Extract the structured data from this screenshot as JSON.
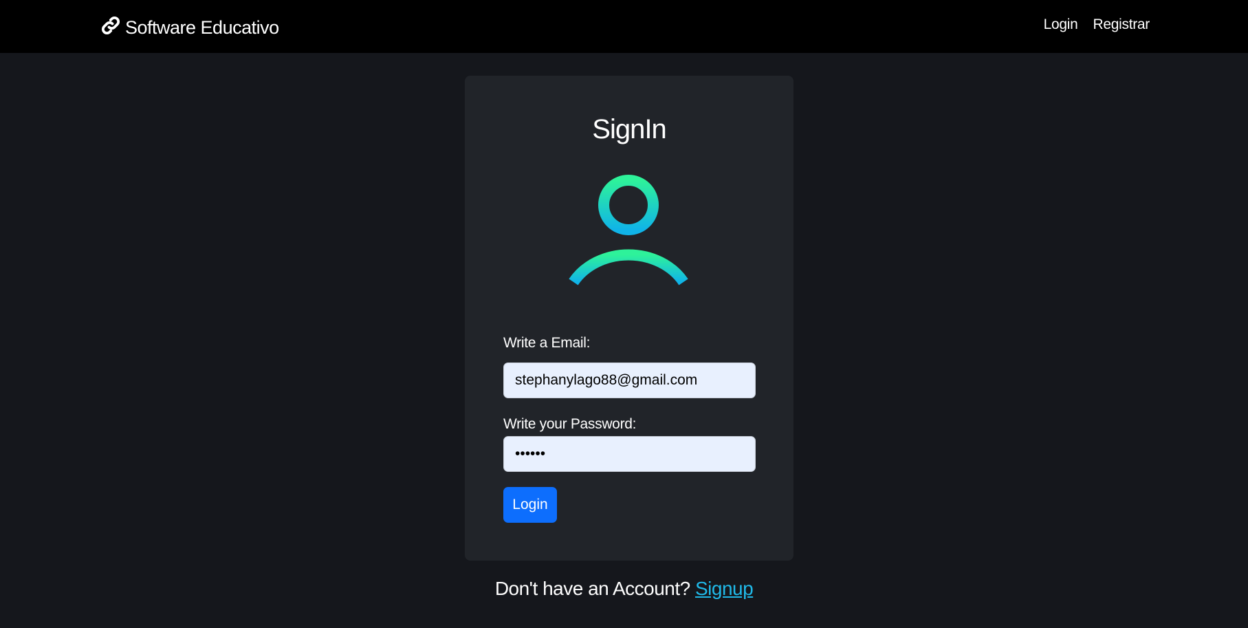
{
  "navbar": {
    "brand": "Software Educativo",
    "brand_icon": "link-icon",
    "links": [
      "Login",
      "Registrar"
    ]
  },
  "card": {
    "title": "SignIn",
    "avatar_icon": "user-icon",
    "gradient": [
      "#2ef29a",
      "#10b4e8"
    ],
    "email": {
      "label": "Write a Email:",
      "value": "stephanylago88@gmail.com"
    },
    "password": {
      "label": "Write your Password:",
      "value": "••••••"
    },
    "submit_label": "Login"
  },
  "footer": {
    "prompt": "Don't have an Account?",
    "link": "Signup"
  },
  "colors": {
    "background": "#15171c",
    "navbar": "#000000",
    "card": "#212429",
    "primary_button": "#0d6efd",
    "link": "#20b9e8",
    "input_bg": "#e8f0fe"
  }
}
